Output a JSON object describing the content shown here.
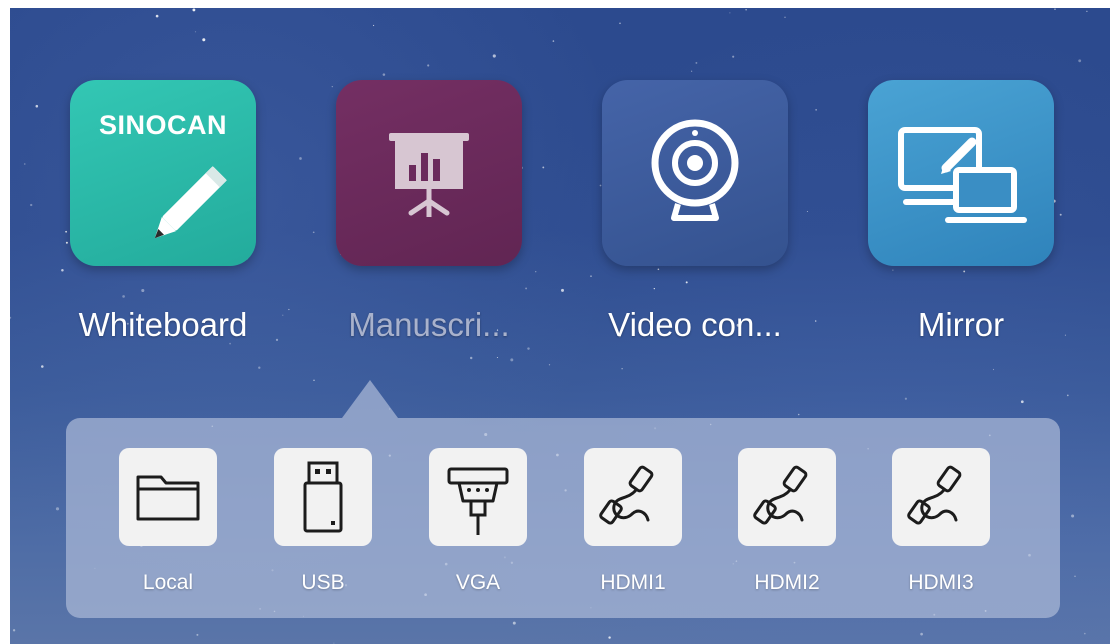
{
  "apps": [
    {
      "label": "Whiteboard",
      "icon": "pen-icon",
      "brand_text": "SINOCAN",
      "color": "#2ab9a8",
      "selected": false
    },
    {
      "label": "Manuscri...",
      "icon": "presentation-chart-icon",
      "color": "#6b2a5c",
      "selected": true
    },
    {
      "label": "Video con...",
      "icon": "webcam-icon",
      "color": "#3d5b9f",
      "selected": false
    },
    {
      "label": "Mirror",
      "icon": "screen-mirror-icon",
      "color": "#3a8ec4",
      "selected": false
    }
  ],
  "sources": [
    {
      "label": "Local",
      "icon": "folder-icon"
    },
    {
      "label": "USB",
      "icon": "usb-drive-icon"
    },
    {
      "label": "VGA",
      "icon": "vga-connector-icon"
    },
    {
      "label": "HDMI1",
      "icon": "hdmi-cable-icon"
    },
    {
      "label": "HDMI2",
      "icon": "hdmi-cable-icon"
    },
    {
      "label": "HDMI3",
      "icon": "hdmi-cable-icon"
    }
  ]
}
